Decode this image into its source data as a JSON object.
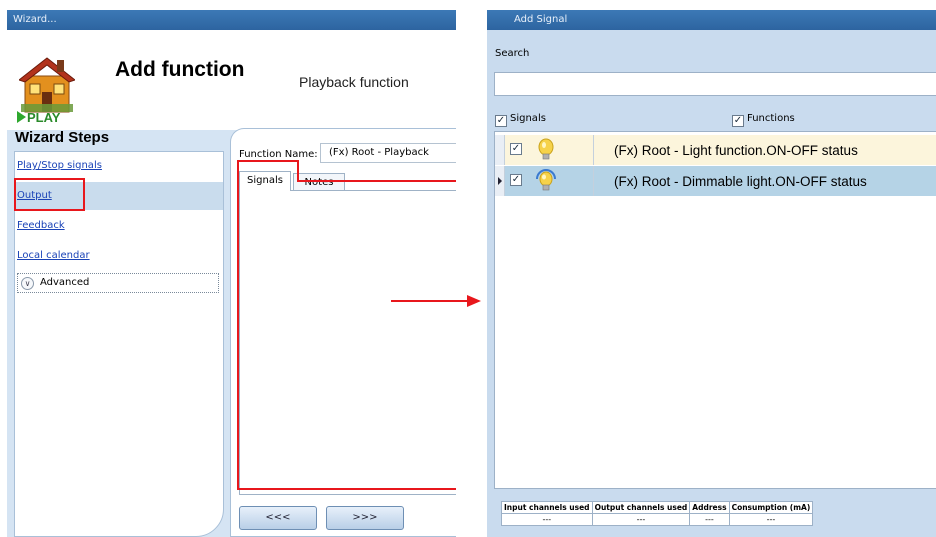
{
  "wizard": {
    "window_title": "Wizard...",
    "header_title": "Add function",
    "header_subtitle": "Playback function",
    "logo_text": "PLAY",
    "steps_title": "Wizard Steps",
    "steps": [
      {
        "label": "Play/Stop signals"
      },
      {
        "label": "Output"
      },
      {
        "label": "Feedback"
      },
      {
        "label": "Local calendar"
      }
    ],
    "advanced_label": "Advanced",
    "function_name_label": "Function Name:",
    "function_name_value": "(Fx) Root - Playback",
    "tabs": [
      {
        "label": "Signals"
      },
      {
        "label": "Notes"
      }
    ],
    "back_button": "<<<",
    "next_button": ">>>"
  },
  "add_signal": {
    "window_title": "Add Signal",
    "search_label": "Search",
    "search_value": "",
    "signals_checkbox": {
      "label": "Signals",
      "checked": true
    },
    "functions_checkbox": {
      "label": "Functions",
      "checked": true
    },
    "rows": [
      {
        "checked": true,
        "icon": "light-bulb-icon",
        "text": "(Fx) Root - Light function.ON-OFF status"
      },
      {
        "checked": true,
        "icon": "dimmable-bulb-icon",
        "text": "(Fx) Root - Dimmable light.ON-OFF status"
      }
    ],
    "info_table": {
      "headers": [
        "Input channels used",
        "Output channels used",
        "Address",
        "Consumption (mA)"
      ],
      "values": [
        "---",
        "---",
        "---",
        "---"
      ]
    }
  },
  "colors": {
    "highlight_red": "#e8171c",
    "titlebar_blue": "#2d64a0",
    "selected_row": "#b5d3e6",
    "first_row": "#fcf5dc"
  }
}
